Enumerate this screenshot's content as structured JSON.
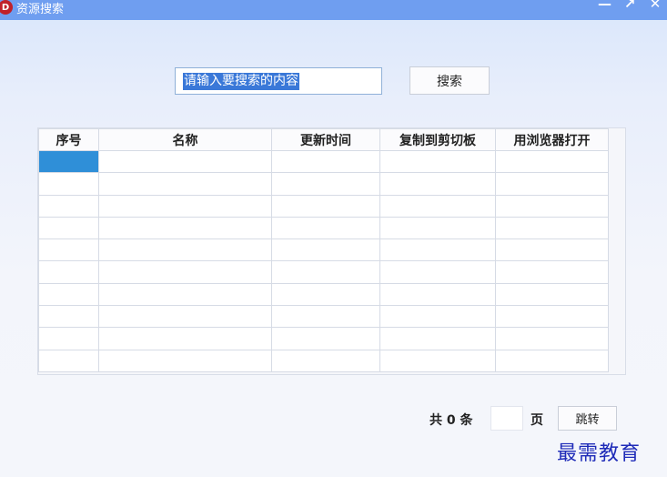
{
  "window": {
    "title": "资源搜索",
    "icon_letter": "D",
    "controls": {
      "minimize": "—",
      "maximize": "↗",
      "close": "✕"
    }
  },
  "search": {
    "input_value": "请输入要搜索的内容",
    "button_label": "搜索"
  },
  "table": {
    "columns": [
      "序号",
      "名称",
      "更新时间",
      "复制到剪切板",
      "用浏览器打开"
    ],
    "row_count": 10,
    "rows": [],
    "selected_row": 0,
    "selected_color": "#2f8fd8"
  },
  "footer": {
    "total_text": "共 0 条",
    "page_input_value": "",
    "page_label": "页",
    "jump_button_label": "跳转"
  },
  "watermark": "最需教育"
}
